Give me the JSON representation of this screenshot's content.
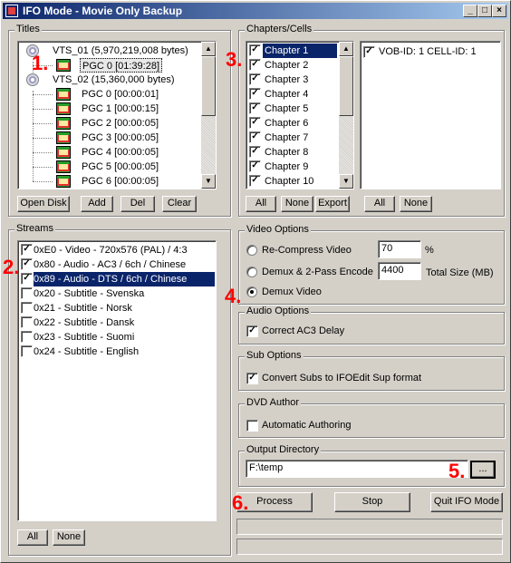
{
  "window": {
    "title": "IFO Mode - Movie Only Backup",
    "minimize": "_",
    "maximize": "□",
    "close": "×"
  },
  "titles": {
    "label": "Titles",
    "items": [
      {
        "text": "VTS_01   (5,970,219,008 bytes)",
        "kind": "disc"
      },
      {
        "text": "PGC 0 [01:39:28]",
        "kind": "pgc",
        "selected": true
      },
      {
        "text": "VTS_02   (15,360,000 bytes)",
        "kind": "disc"
      },
      {
        "text": "PGC 0 [00:00:01]",
        "kind": "pgc"
      },
      {
        "text": "PGC 1 [00:00:15]",
        "kind": "pgc"
      },
      {
        "text": "PGC 2 [00:00:05]",
        "kind": "pgc"
      },
      {
        "text": "PGC 3 [00:00:05]",
        "kind": "pgc"
      },
      {
        "text": "PGC 4 [00:00:05]",
        "kind": "pgc"
      },
      {
        "text": "PGC 5 [00:00:05]",
        "kind": "pgc"
      },
      {
        "text": "PGC 6 [00:00:05]",
        "kind": "pgc"
      }
    ],
    "buttons": {
      "open": "Open Disk",
      "add": "Add",
      "del": "Del",
      "clear": "Clear"
    }
  },
  "chapters": {
    "label": "Chapters/Cells",
    "items": [
      {
        "text": "Chapter 1",
        "checked": true,
        "selected": true
      },
      {
        "text": "Chapter 2",
        "checked": true
      },
      {
        "text": "Chapter 3",
        "checked": true
      },
      {
        "text": "Chapter 4",
        "checked": true
      },
      {
        "text": "Chapter 5",
        "checked": true
      },
      {
        "text": "Chapter 6",
        "checked": true
      },
      {
        "text": "Chapter 7",
        "checked": true
      },
      {
        "text": "Chapter 8",
        "checked": true
      },
      {
        "text": "Chapter 9",
        "checked": true
      },
      {
        "text": "Chapter 10",
        "checked": true
      }
    ],
    "cells": [
      {
        "text": "VOB-ID: 1 CELL-ID: 1",
        "checked": true
      }
    ],
    "buttons": {
      "all": "All",
      "none": "None",
      "export": "Export",
      "all2": "All",
      "none2": "None"
    }
  },
  "streams": {
    "label": "Streams",
    "items": [
      {
        "text": "0xE0 - Video - 720x576 (PAL) / 4:3",
        "checked": true
      },
      {
        "text": "0x80 - Audio - AC3 / 6ch / Chinese",
        "checked": true
      },
      {
        "text": "0x89 - Audio - DTS / 6ch / Chinese",
        "checked": true,
        "selected": true
      },
      {
        "text": "0x20 - Subtitle - Svenska",
        "checked": false
      },
      {
        "text": "0x21 - Subtitle - Norsk",
        "checked": false
      },
      {
        "text": "0x22 - Subtitle - Dansk",
        "checked": false
      },
      {
        "text": "0x23 - Subtitle - Suomi",
        "checked": false
      },
      {
        "text": "0x24 - Subtitle - English",
        "checked": false
      }
    ],
    "buttons": {
      "all": "All",
      "none": "None"
    }
  },
  "video_options": {
    "label": "Video Options",
    "recompress": "Re-Compress Video",
    "recompress_value": "70",
    "recompress_unit": "%",
    "demux2pass": "Demux & 2-Pass Encode",
    "demux2pass_value": "4400",
    "demux2pass_unit": "Total Size (MB)",
    "demux": "Demux Video",
    "selected": "demux"
  },
  "audio_options": {
    "label": "Audio Options",
    "ac3": "Correct AC3 Delay",
    "ac3_checked": true
  },
  "sub_options": {
    "label": "Sub Options",
    "convert": "Convert Subs to IFOEdit Sup format",
    "convert_checked": true
  },
  "dvd_author": {
    "label": "DVD Author",
    "auto": "Automatic Authoring",
    "auto_checked": false
  },
  "output": {
    "label": "Output Directory",
    "path": "F:\\temp",
    "browse": "..."
  },
  "actions": {
    "process": "Process",
    "stop": "Stop",
    "quit": "Quit IFO Mode"
  },
  "annotations": {
    "a1": "1.",
    "a2": "2.",
    "a3": "3.",
    "a4": "4.",
    "a5": "5.",
    "a6": "6."
  },
  "colors": {
    "face": "#d4d0c8",
    "selection": "#0a246a",
    "annotation": "#ff0000"
  }
}
